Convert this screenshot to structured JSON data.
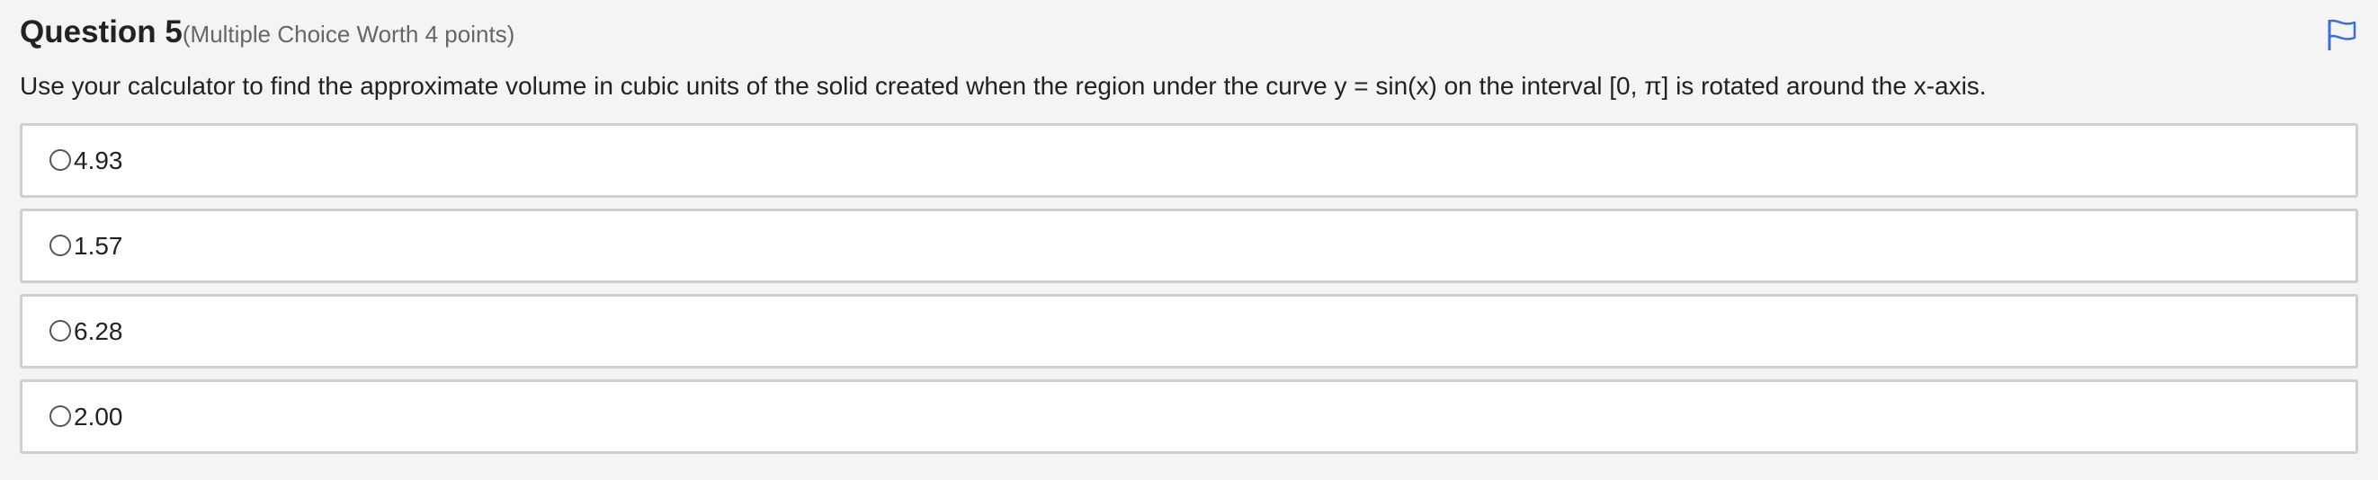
{
  "question": {
    "title": "Question 5",
    "subtitle": "(Multiple Choice Worth 4 points)",
    "prompt": "Use your calculator to find the approximate volume in cubic units of the solid created when the region under the curve y = sin(x) on the interval [0, π] is rotated around the x-axis.",
    "flag_icon": "flag-icon",
    "accent_color": "#3b6fd4"
  },
  "choices": [
    {
      "label": "4.93"
    },
    {
      "label": "1.57"
    },
    {
      "label": "6.28"
    },
    {
      "label": "2.00"
    }
  ]
}
